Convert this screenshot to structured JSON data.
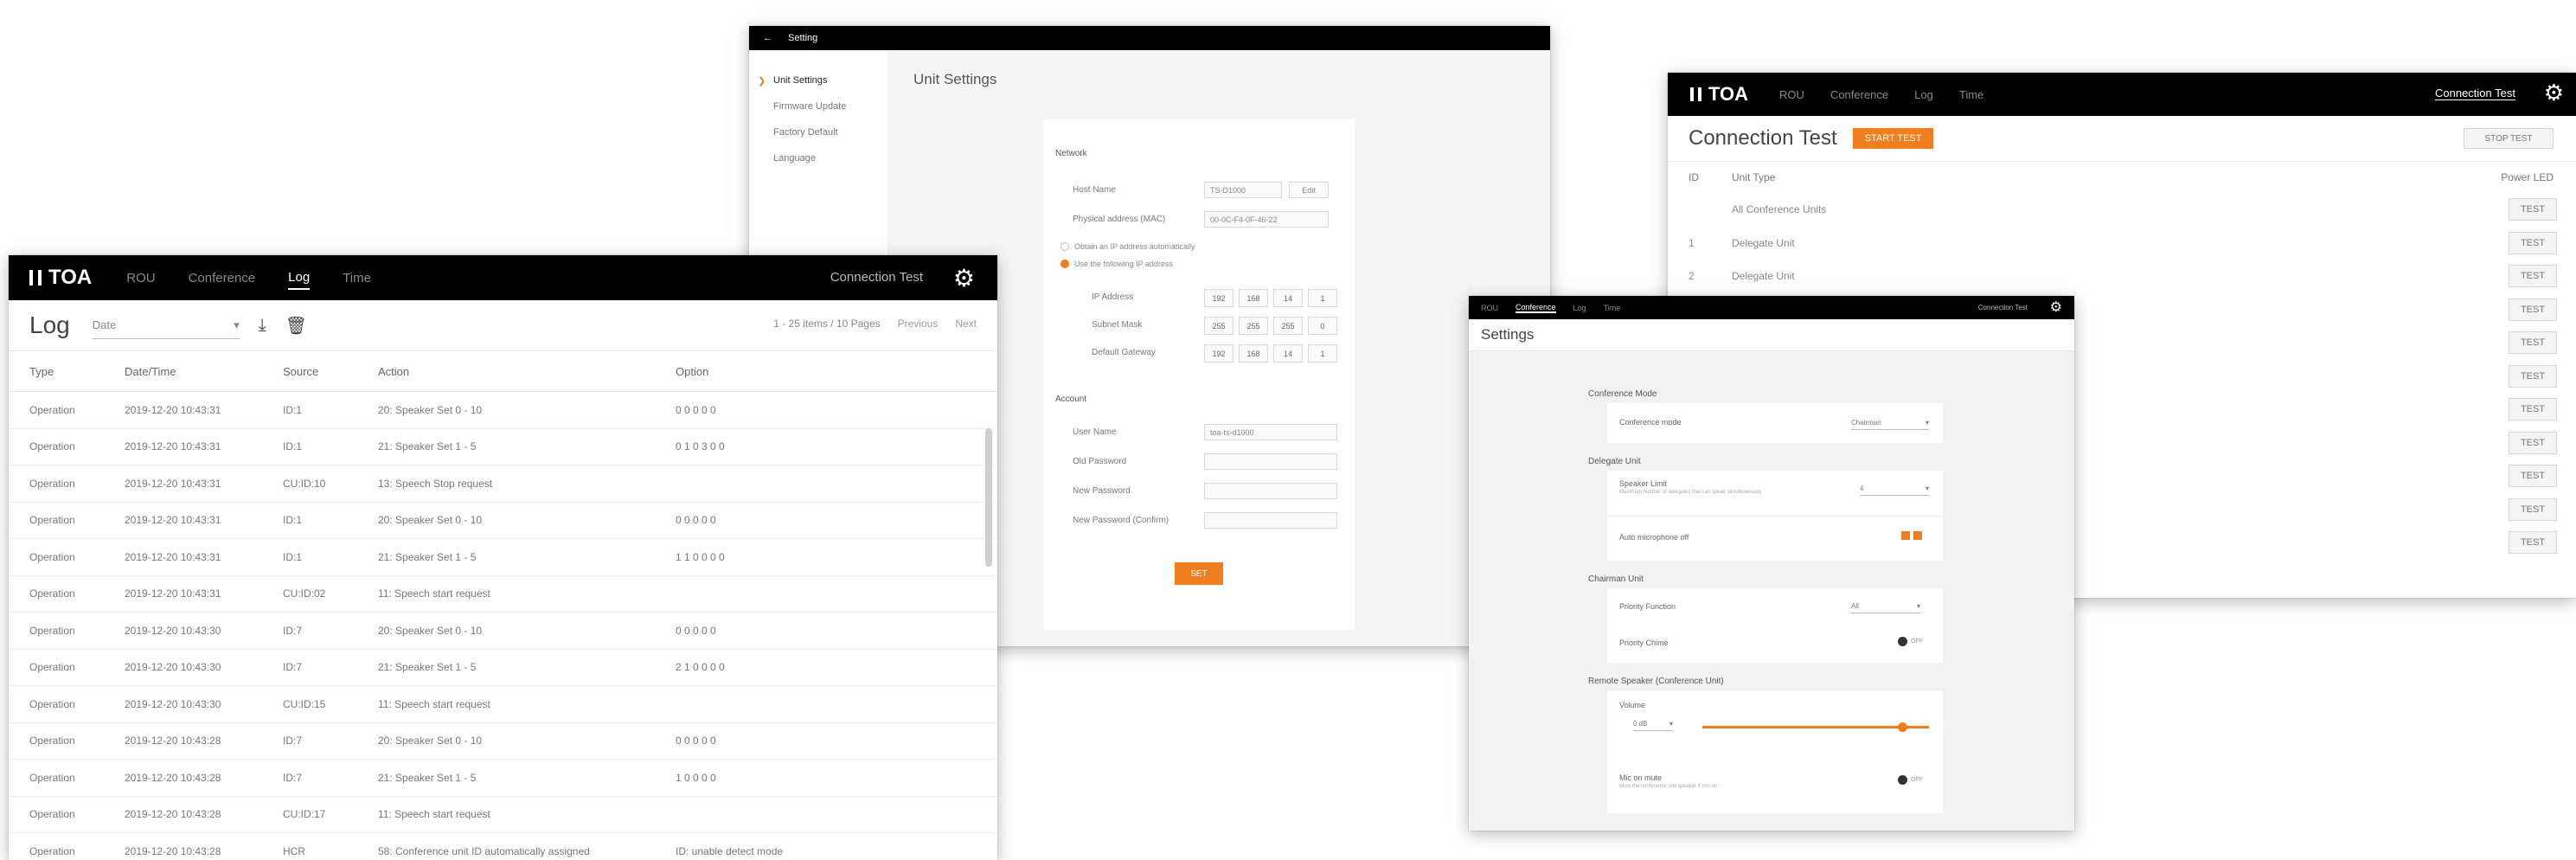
{
  "log_window": {
    "brand": "TOA",
    "nav": [
      "ROU",
      "Conference",
      "Log",
      "Time"
    ],
    "active_nav": "Log",
    "connection_test": "Connection Test",
    "title": "Log",
    "filter_value": "Date",
    "paging": "1 - 25 items  /  10 Pages",
    "prev": "Previous",
    "next": "Next",
    "columns": [
      "Type",
      "Date/Time",
      "Source",
      "Action",
      "Option"
    ],
    "rows": [
      [
        "Operation",
        "2019-12-20 10:43:31",
        "ID:1",
        "20: Speaker Set 0 - 10",
        "0 0 0 0 0"
      ],
      [
        "Operation",
        "2019-12-20 10:43:31",
        "ID:1",
        "21: Speaker Set 1 - 5",
        "0 1 0 3 0 0"
      ],
      [
        "Operation",
        "2019-12-20 10:43:31",
        "CU:ID:10",
        "13: Speech Stop request",
        ""
      ],
      [
        "Operation",
        "2019-12-20 10:43:31",
        "ID:1",
        "20: Speaker Set 0 - 10",
        "0 0 0 0 0"
      ],
      [
        "Operation",
        "2019-12-20 10:43:31",
        "ID:1",
        "21: Speaker Set 1 - 5",
        "1 1 0 0 0 0"
      ],
      [
        "Operation",
        "2019-12-20 10:43:31",
        "CU:ID:02",
        "11: Speech start request",
        ""
      ],
      [
        "Operation",
        "2019-12-20 10:43:30",
        "ID:7",
        "20: Speaker Set 0 - 10",
        "0 0 0 0 0"
      ],
      [
        "Operation",
        "2019-12-20 10:43:30",
        "ID:7",
        "21: Speaker Set 1 - 5",
        "2 1 0 0 0 0"
      ],
      [
        "Operation",
        "2019-12-20 10:43:30",
        "CU:ID:15",
        "11: Speech start request",
        ""
      ],
      [
        "Operation",
        "2019-12-20 10:43:28",
        "ID:7",
        "20: Speaker Set 0 - 10",
        "0 0 0 0 0"
      ],
      [
        "Operation",
        "2019-12-20 10:43:28",
        "ID:7",
        "21: Speaker Set 1 - 5",
        "1 0 0 0 0"
      ],
      [
        "Operation",
        "2019-12-20 10:43:28",
        "CU:ID:17",
        "11: Speech start request",
        ""
      ],
      [
        "Operation",
        "2019-12-20 10:43:28",
        "HCR",
        "58: Conference unit ID automatically assigned",
        "ID: unable detect mode"
      ]
    ]
  },
  "unit_window": {
    "header": "Setting",
    "sidebar": [
      "Unit Settings",
      "Firmware Update",
      "Factory Default",
      "Language"
    ],
    "active_sidebar": "Unit Settings",
    "title": "Unit Settings",
    "network_label": "Network",
    "host_name_label": "Host Name",
    "host_name_value": "TS-D1000",
    "host_edit": "Edit",
    "mac_label": "Physical address (MAC)",
    "mac_value": "00-0C-F4-0F-46-22",
    "radio_auto": "Obtain an IP address automatically",
    "radio_manual": "Use the following IP address",
    "ip_label": "IP Address",
    "ip_value": [
      "192",
      "168",
      "14",
      "1"
    ],
    "subnet_label": "Subnet Mask",
    "subnet_value": [
      "255",
      "255",
      "255",
      "0"
    ],
    "gateway_label": "Default Gateway",
    "gateway_value": [
      "192",
      "168",
      "14",
      "1"
    ],
    "account_label": "Account",
    "user_label": "User Name",
    "user_value": "toa-ts-d1000",
    "old_pw_label": "Old Password",
    "new_pw_label": "New Password",
    "new_pw_confirm_label": "New Password (Confirm)",
    "set_button": "SET"
  },
  "conn_window": {
    "brand": "TOA",
    "nav": [
      "ROU",
      "Conference",
      "Log",
      "Time"
    ],
    "connection_test": "Connection Test",
    "title": "Connection Test",
    "start": "START TEST",
    "stop": "STOP TEST",
    "col_id": "ID",
    "col_type": "Unit Type",
    "col_power": "Power LED",
    "rows": [
      {
        "id": "",
        "type": "All Conference Units",
        "btn": "TEST"
      },
      {
        "id": "1",
        "type": "Delegate Unit",
        "btn": "TEST"
      },
      {
        "id": "2",
        "type": "Delegate Unit",
        "btn": "TEST"
      },
      {
        "id": "",
        "type": "",
        "btn": "TEST"
      },
      {
        "id": "",
        "type": "",
        "btn": "TEST"
      },
      {
        "id": "",
        "type": "",
        "btn": "TEST"
      },
      {
        "id": "",
        "type": "",
        "btn": "TEST"
      },
      {
        "id": "",
        "type": "",
        "btn": "TEST"
      },
      {
        "id": "",
        "type": "",
        "btn": "TEST"
      },
      {
        "id": "",
        "type": "",
        "btn": "TEST"
      },
      {
        "id": "",
        "type": "",
        "btn": "TEST"
      }
    ]
  },
  "conf_window": {
    "nav": [
      "ROU",
      "Conference",
      "Log",
      "Time"
    ],
    "active_nav": "Conference",
    "connection_test": "Connection Test",
    "title": "Settings",
    "sec1": "Conference Mode",
    "mode_label": "Conference mode",
    "mode_value": "Chairman",
    "sec2": "Delegate Unit",
    "limit_label": "Speaker Limit",
    "limit_sub": "Maximum number of delegates that can speak simultaneously",
    "limit_value": "4",
    "auto_off_label": "Auto microphone off",
    "sec3": "Chairman Unit",
    "priority_label": "Priority Function",
    "priority_value": "All",
    "chime_label": "Priority Chime",
    "chime_value": "OFF",
    "sec4": "Remote Speaker (Conference Unit)",
    "volume_label": "Volume",
    "volume_value": "0 dB",
    "volume_level": 0.88,
    "mute_label": "Mic on mute",
    "mute_sub": "Mute the conference unit speaker if mic on",
    "mute_value": "OFF"
  },
  "colors": {
    "accent": "#f07d1e",
    "topbar": "#000000"
  },
  "icons": [
    "download-icon",
    "trash-icon",
    "gear-icon",
    "chevron-right-icon",
    "chevron-down-icon",
    "back-arrow-icon"
  ]
}
